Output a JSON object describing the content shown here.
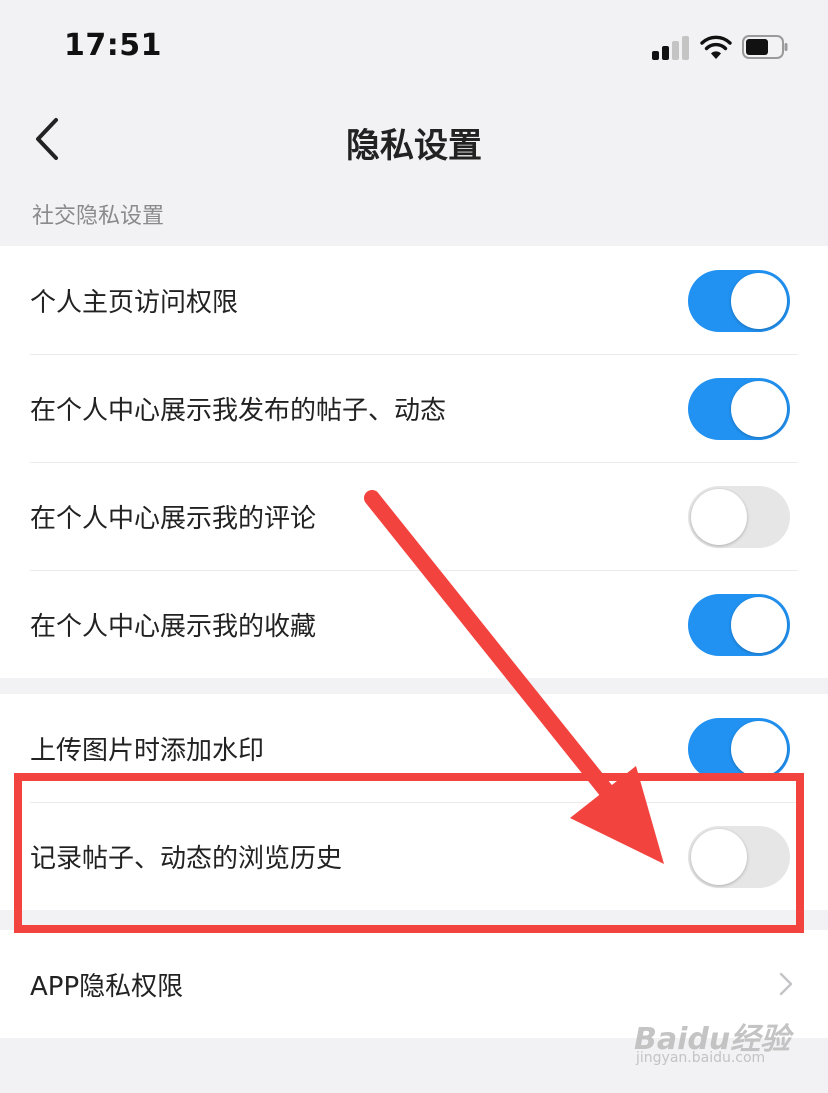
{
  "status_bar": {
    "time": "17:51",
    "icons": [
      "cellular-signal-icon",
      "wifi-icon",
      "battery-icon"
    ]
  },
  "nav": {
    "title": "隐私设置",
    "back_icon": "chevron-left-icon"
  },
  "section": {
    "label": "社交隐私设置"
  },
  "group1": [
    {
      "label": "个人主页访问权限",
      "toggle": "on"
    },
    {
      "label": "在个人中心展示我发布的帖子、动态",
      "toggle": "on"
    },
    {
      "label": "在个人中心展示我的评论",
      "toggle": "off"
    },
    {
      "label": "在个人中心展示我的收藏",
      "toggle": "on"
    }
  ],
  "group2": [
    {
      "label": "上传图片时添加水印",
      "toggle": "on"
    },
    {
      "label": "记录帖子、动态的浏览历史",
      "toggle": "off"
    }
  ],
  "group3": [
    {
      "label": "APP隐私权限",
      "icon": "chevron-right-icon"
    }
  ],
  "watermark": {
    "logo": "Baidu经验",
    "sub": "jingyan.baidu.com"
  },
  "colors": {
    "toggle_on": "#2192f2",
    "toggle_off": "#e6e6e6",
    "annotation": "#f2433f",
    "background": "#f2f2f4"
  }
}
